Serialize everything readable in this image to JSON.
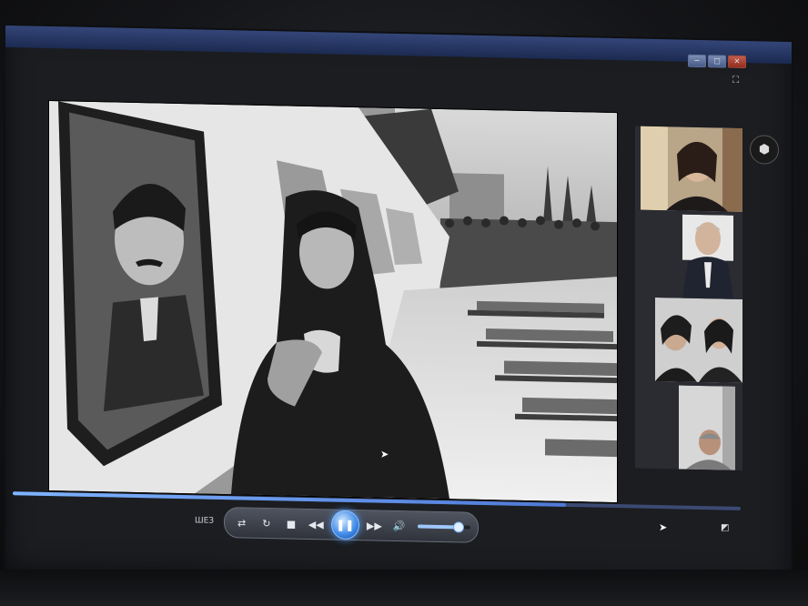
{
  "window": {
    "controls": {
      "minimize": "−",
      "maximize": "□",
      "close": "✕"
    },
    "fullscreen_icon": "⛶"
  },
  "player": {
    "layout_label": "ШЕЗ",
    "buttons": {
      "shuffle": "⇄",
      "repeat": "↻",
      "stop": "■",
      "previous": "◀◀",
      "play_pause": "❚❚",
      "next": "▶▶",
      "volume": "🔊"
    },
    "progress": 0.76,
    "volume": 0.75,
    "switch_to_library_icon": "◩"
  },
  "participants": {
    "count": 4,
    "side_icon": "⬢"
  },
  "colors": {
    "accent": "#3d88e6",
    "titlebar": "#1c2d5a",
    "screen_bg": "#1b1d21"
  }
}
